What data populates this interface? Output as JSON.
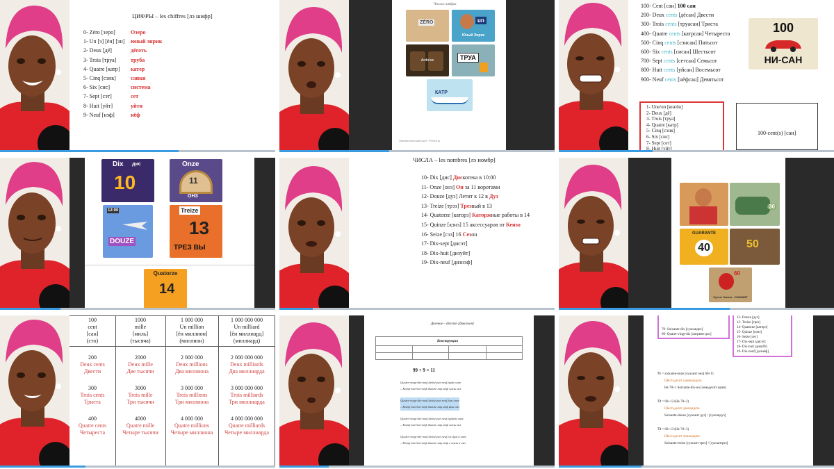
{
  "progress": [
    0.65,
    0.4,
    0.34,
    0.22,
    0.12,
    0.62,
    0.31,
    0.18,
    0.3
  ],
  "tile1": {
    "title": "ЦИФРЫ – les chiffres [лэ шифр]",
    "rows": [
      {
        "fr": "0- Zéro [зеро]",
        "ru": "Озеро"
      },
      {
        "fr": "1- Un [э] [ён] [эн]",
        "ru": "юный энрик"
      },
      {
        "fr": "2- Deux [дё]",
        "ru": "дёготь"
      },
      {
        "fr": "3- Trois [труа]",
        "ru": "труба"
      },
      {
        "fr": "4- Quatre [катр]",
        "ru": "катер"
      },
      {
        "fr": "5- Cinq [сэнк]",
        "ru": "санки"
      },
      {
        "fr": "6- Six [сис]",
        "ru": "система"
      },
      {
        "fr": "7- Sept [сэт]",
        "ru": "сет"
      },
      {
        "fr": "8- Huit [уйт]",
        "ru": "уйти"
      },
      {
        "fr": "9- Neuf [нэф]",
        "ru": "нёф"
      }
    ]
  },
  "tile2": {
    "header": "Числа и цифры",
    "img_zero": "ZÉRO",
    "img_un": "un",
    "img_un_caption": "Юный Энрик",
    "img_drum": "Ardoise",
    "img_trua": "ТРУА",
    "img_katr": "КАТР",
    "footer": "Лингвистический пакет - French.ru"
  },
  "tile3": {
    "rows": [
      {
        "a": "100- Cent [сан] ",
        "b": "100 сан",
        "c": ""
      },
      {
        "a": "200- Deux ",
        "b": "cents",
        "c": " [дёсан] Двести"
      },
      {
        "a": "300- Trois ",
        "b": "cents",
        "c": " [труасан] Триста"
      },
      {
        "a": "400- Quatre ",
        "b": "cents",
        "c": " [катрсан] Четыреста"
      },
      {
        "a": "500- Cinq ",
        "b": "cents",
        "c": " [сэнсан] Пятьсот"
      },
      {
        "a": "600- Six ",
        "b": "cents",
        "c": " [сисан] Шестьсот"
      },
      {
        "a": "700- Sept ",
        "b": "cents",
        "c": " [сетсан] Семьсот"
      },
      {
        "a": "800- Huit ",
        "b": "cents",
        "c": " [уйсан] Восемьсот"
      },
      {
        "a": "900- Neuf ",
        "b": "cents",
        "c": " [нёфсан] Девятьсот"
      }
    ],
    "logo_num": "100",
    "logo_text": "НИ-САН",
    "box_rows": [
      "1- Une/un [юн/ён]",
      "2- Deux [дё]",
      "3- Trois [труа]",
      "4- Quatre [катр]",
      "5- Cinq [сэнк]",
      "6- Six [сис]",
      "7- Sept [сет]",
      "8- Huit [уйт]"
    ],
    "box2": "100-cent(s) [сан]"
  },
  "tile4": {
    "dix": "Dix",
    "dix_ru": "дис",
    "dix_num": "10",
    "onze": "Onze",
    "onze_ru": "ОНЗ",
    "onze_num": "11",
    "douze": "DOUZE",
    "douze_time": "12:00",
    "treize": "Treize",
    "treize_ru": "ТРЕЗ ВЫ",
    "treize_num": "13",
    "quatorze": "Quatorze",
    "quatorze_num": "14"
  },
  "tile5": {
    "title": "ЧИСЛА – les nombres [лэ номбр]",
    "rows": [
      {
        "a": "10- Dix [дис]  ",
        "b": "Дис",
        "c": "котека в 10:00"
      },
      {
        "a": "11- Onze [онз]  ",
        "b": "Он",
        "c": " за 11 воротами"
      },
      {
        "a": "12- Douze [дуз]  Летит к 12 в ",
        "b": "Дуз",
        "c": ""
      },
      {
        "a": "13- Treize [трэз]  ",
        "b": "Трез",
        "c": "вый в 13"
      },
      {
        "a": "14- Quatorze [каторз]  ",
        "b": "Каторж",
        "c": "ные работы в 14"
      },
      {
        "a": "15- Quinze [кэнз] 15 аксессуаров от ",
        "b": "Кензо",
        "c": ""
      },
      {
        "a": "16- Seize [сэз] 16 ",
        "b": "Сез",
        "c": "он"
      },
      {
        "a": "17- Dix-sept [дисэт]",
        "b": "",
        "c": ""
      },
      {
        "a": "18- Dix-huit [дизуйт]",
        "b": "",
        "c": ""
      },
      {
        "a": "19- Dix-neuf [дизнэф]",
        "b": "",
        "c": ""
      }
    ]
  },
  "tile6": {
    "img_guarantee": "GUARANTE",
    "img_40": "40",
    "img_50": "50",
    "img_30": "30",
    "img_60": "60",
    "caption": "Суп от Санты - СУАСАНТ"
  },
  "tile7": {
    "headers": [
      [
        "100",
        "cent",
        "[сан]",
        "(сто)"
      ],
      [
        "1000",
        "mille",
        "[миль]",
        "(тысяча)"
      ],
      [
        "1 000 000",
        "Un million",
        "[ён миллион]",
        "(миллион)"
      ],
      [
        "1 000 000 000",
        "Un milliard",
        "[ён миллиард]",
        "(миллиард)"
      ]
    ],
    "cols": [
      [
        [
          "200",
          "Deux cents",
          "Двести"
        ],
        [
          "300",
          "Trois cents",
          "Триста"
        ],
        [
          "400",
          "Quatre cents",
          "Четыреста"
        ]
      ],
      [
        [
          "2000",
          "Deux mille",
          "Две тысячи"
        ],
        [
          "3000",
          "Trois mille",
          "Три тысячи"
        ],
        [
          "4000",
          "Quatre mille",
          "Четыре тысячи"
        ]
      ],
      [
        [
          "2 000 000",
          "Deux millions",
          "Два миллиона"
        ],
        [
          "3 000 000",
          "Trois millions",
          "Три миллиона"
        ],
        [
          "4 000 000",
          "Quatre millions",
          "Четыре миллиона"
        ]
      ],
      [
        [
          "2 000 000 000",
          "Deux milliards",
          "Два миллиарда"
        ],
        [
          "3 000 000 000",
          "Trois milliards",
          "Три миллиарда"
        ],
        [
          "4 000 000 000",
          "Quatre milliards",
          "Четыре миллиарда"
        ]
      ]
    ]
  },
  "tile8": {
    "heading": "Деление – division [дивизьон]",
    "table_header": "Конструкция",
    "equation": "99 ÷ 9 = 11",
    "lines": [
      "Quatre-vingt-dix-neuf divisé par neuf égale onze",
      "– Катр-вэн-дис-нёф дивизе пар нёф эгаль онз",
      "Quatre-vingt-dix-neuf divisé par neuf font onze",
      "– Катр-вэн-дис-нёф дивизе пар нёф фон онз",
      "Quatre-vingt-dix-neuf divisé par neuf égalent onze",
      "– Катр-вэн-дис-нёф дивизе пар нёф эгаль онз",
      "Quatre-vingt-dix-neuf divisé par neuf est égal à onze",
      "– Катр-вэн-дис-нёф дивизе пар нёф э эгаль а онз"
    ]
  },
  "tile9": {
    "box1": [
      "70- Soixante-dix [суасандис]",
      "90- Quatre-vingt-dix [катрвэн-дис]"
    ],
    "box2": [
      "12- Douze [дуз]",
      "13- Treize [трез]",
      "14- Quatorze [каторз]",
      "15- Quinze [кэнз]",
      "16- Seize [сез]",
      "17- Dix-sept [дисэт]",
      "18- Dix-huit [дизуйт]",
      "19- Dix-neuf [дизнёф]"
    ],
    "sections": [
      {
        "num": "71",
        "eq": " = soixante-onze [суасант онз] 60+11",
        "ru": "Шестьдесят одиннадцать",
        "note": "Не 70+1   Soixante-dix-un (семьдесят один)"
      },
      {
        "num": "72",
        "eq": " = 60+12 (Не 70+2)",
        "ru": "Шестьдесят двенадцать",
        "note": "Soixante-douze [суасант дуз] / [суасандуз]"
      },
      {
        "num": "73",
        "eq": " = 60+13 (Не 70+3)",
        "ru": "Шестьдесят тринадцать",
        "note": "Soixante-treize [суасант трез] / [суасантрез]"
      }
    ]
  }
}
